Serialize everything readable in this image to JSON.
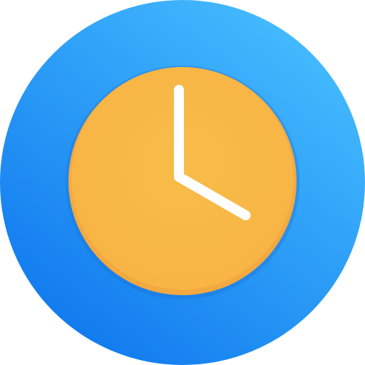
{
  "app_icon": {
    "icon": "clock-icon",
    "time": {
      "hours": 4,
      "minutes": 0
    },
    "colors": {
      "ring_light": "#46BDFE",
      "ring_dark": "#0F78EE",
      "inner_shadow": "#1E6FD6",
      "face_light": "#F8BC48",
      "face_dark": "#F7B446",
      "face_rim": "#F3A93F",
      "hands": "#FFFFFF"
    }
  }
}
